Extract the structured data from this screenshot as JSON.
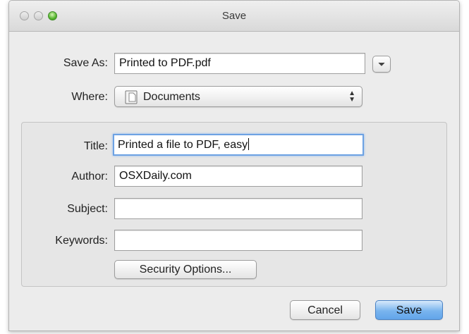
{
  "window": {
    "title": "Save"
  },
  "save_as": {
    "label": "Save As:",
    "value": "Printed to PDF.pdf"
  },
  "where": {
    "label": "Where:",
    "value": "Documents"
  },
  "title_field": {
    "label": "Title:",
    "value": "Printed a file to PDF, easy"
  },
  "author_field": {
    "label": "Author:",
    "value": "OSXDaily.com"
  },
  "subject_field": {
    "label": "Subject:",
    "value": ""
  },
  "keywords_field": {
    "label": "Keywords:",
    "value": ""
  },
  "buttons": {
    "security": "Security Options...",
    "cancel": "Cancel",
    "save": "Save"
  },
  "icons": {
    "expand": "chevron-down-icon",
    "folder": "document-folder-icon",
    "select": "updown-arrows-icon"
  },
  "colors": {
    "focus_ring": "#6da2e3",
    "default_button": "#79b4ee"
  }
}
